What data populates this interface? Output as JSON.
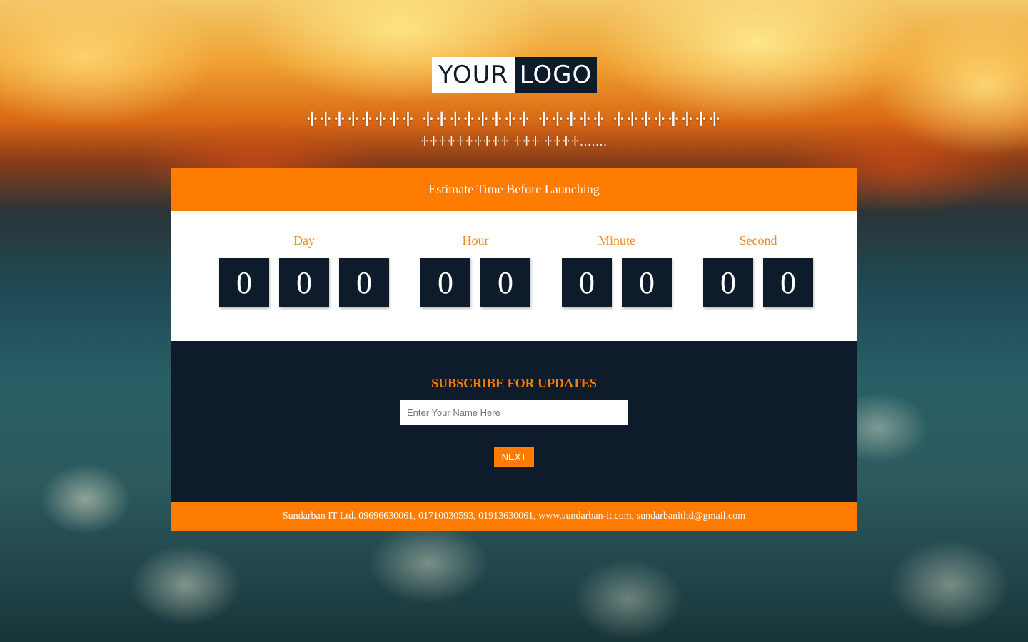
{
  "logo": {
    "left_text": "YOUR",
    "right_text": "LOGO"
  },
  "headline": "𑀈𑀈𑀈𑀈𑀈𑀈𑀈𑀈 𑀈𑀈𑀈𑀈𑀈𑀈𑀈𑀈 𑀈𑀈𑀈𑀈𑀈 𑀈𑀈𑀈𑀈𑀈𑀈𑀈𑀈",
  "subline": "𑀈𑀈𑀈𑀈𑀈𑀈𑀈𑀈𑀈𑀈 𑀈𑀈𑀈 𑀈𑀈𑀈𑀈.......",
  "panel": {
    "header": "Estimate Time Before Launching"
  },
  "countdown": {
    "units": [
      {
        "label": "Day",
        "digits": [
          "0",
          "0",
          "0"
        ]
      },
      {
        "label": "Hour",
        "digits": [
          "0",
          "0"
        ]
      },
      {
        "label": "Minute",
        "digits": [
          "0",
          "0"
        ]
      },
      {
        "label": "Second",
        "digits": [
          "0",
          "0"
        ]
      }
    ]
  },
  "subscribe": {
    "title": "SUBSCRIBE FOR UPDATES",
    "name_placeholder": "Enter Your Name Here",
    "name_value": "",
    "next_label": "NEXT"
  },
  "footer": {
    "text": "Sundarban IT Ltd. 09696630061, 01710030593, 01913630061, www.sundarban-it.com, sundarbanitltd@gmail.com"
  },
  "colors": {
    "accent": "#ff7c03",
    "navy": "#0d1b2a",
    "label": "#f08a24"
  }
}
